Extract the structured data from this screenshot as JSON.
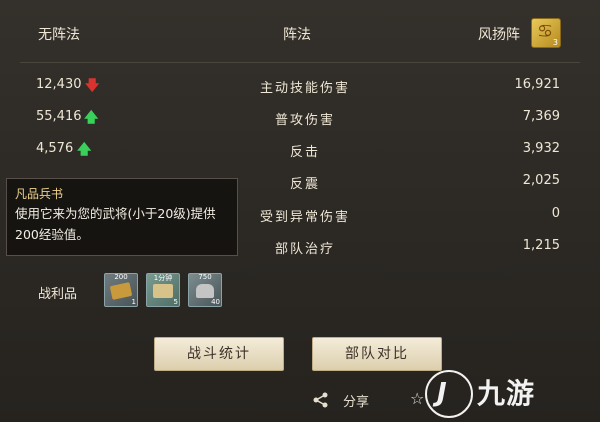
{
  "header": {
    "left_label": "无阵法",
    "mid_label": "阵法",
    "right_label": "风扬阵",
    "formation_icon_level": "3"
  },
  "stats": [
    {
      "left": "12,430",
      "trend": "down",
      "name": "主动技能伤害",
      "right": "16,921"
    },
    {
      "left": "55,416",
      "trend": "up",
      "name": "普攻伤害",
      "right": "7,369"
    },
    {
      "left": "4,576",
      "trend": "up",
      "name": "反击",
      "right": "3,932"
    },
    {
      "left": "",
      "trend": "up",
      "name": "反震",
      "right": "2,025"
    },
    {
      "left": "",
      "trend": "",
      "name": "受到异常伤害",
      "right": "0"
    },
    {
      "left": "",
      "trend": "",
      "name": "部队治疗",
      "right": "1,215"
    }
  ],
  "tooltip": {
    "title": "凡品兵书",
    "body": "使用它来为您的武将(小于20级)提供200经验值。"
  },
  "loot": {
    "label": "战利品",
    "items": [
      {
        "icon": "scroll-bundle-icon",
        "top": "200",
        "qty": "1"
      },
      {
        "icon": "map-scroll-icon",
        "top": "1分钟",
        "qty": "5"
      },
      {
        "icon": "iron-ore-icon",
        "top": "750",
        "qty": "40"
      }
    ]
  },
  "buttons": {
    "stats": "战斗统计",
    "compare": "部队对比"
  },
  "footer": {
    "share": "分享"
  },
  "watermark": {
    "text": "九游"
  }
}
